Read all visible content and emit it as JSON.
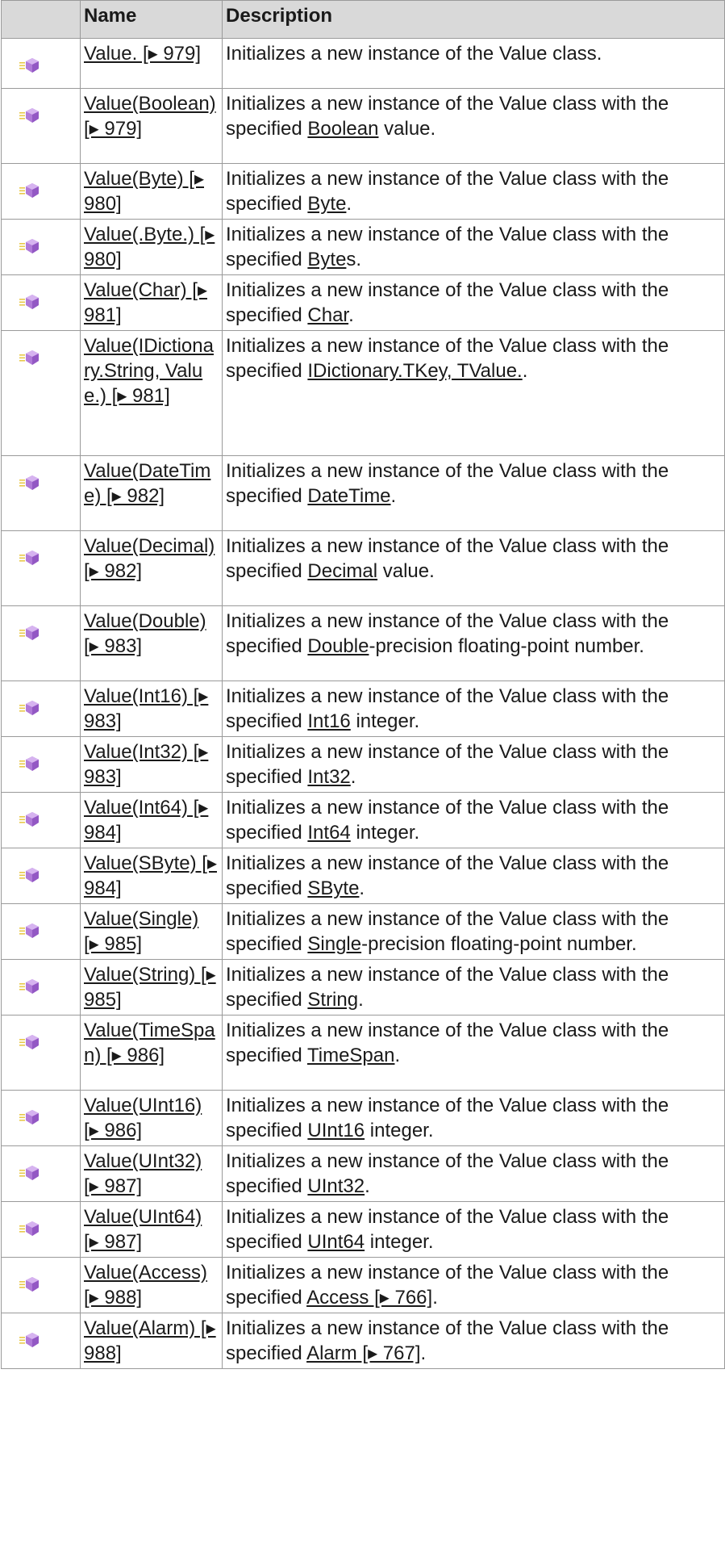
{
  "headers": {
    "icon": "",
    "name": "Name",
    "description": "Description"
  },
  "colors": {
    "header_bg": "#d9d9d9",
    "border": "#9a9a9a",
    "icon_purple": "#b07ad8",
    "icon_yellow": "#e8c94a"
  },
  "rows": [
    {
      "name": "Value. [▸ 979]",
      "pre": "Initializes a new instance of the Value class.",
      "link": "",
      "post": ""
    },
    {
      "name": "Value(Boolean) [▸ 979]",
      "pre": "Initializes a new instance of the Value class with the specified ",
      "link": "Boolean",
      "post": " value."
    },
    {
      "name": "Value(Byte) [▸ 980]",
      "pre": "Initializes a new instance of the Value class with the specified ",
      "link": "Byte",
      "post": "."
    },
    {
      "name": "Value(.Byte.) [▸ 980]",
      "pre": "Initializes a new instance of the Value class with the specified ",
      "link": "Byte",
      "post": "s."
    },
    {
      "name": "Value(Char) [▸ 981]",
      "pre": "Initializes a new instance of the Value class with the specified ",
      "link": "Char",
      "post": "."
    },
    {
      "name": "Value(IDictionary.String, Value.) [▸ 981]",
      "pre": "Initializes a new instance of the Value class with the specified ",
      "link": "IDictionary.TKey, TValue.",
      "post": "."
    },
    {
      "name": "Value(DateTime) [▸ 982]",
      "pre": "Initializes a new instance of the Value class with the specified ",
      "link": "DateTime",
      "post": "."
    },
    {
      "name": "Value(Decimal) [▸ 982]",
      "pre": "Initializes a new instance of the Value class with the specified ",
      "link": "Decimal",
      "post": " value."
    },
    {
      "name": "Value(Double) [▸ 983]",
      "pre": "Initializes a new instance of the Value class with the specified ",
      "link": "Double",
      "post": "-precision floating-point number."
    },
    {
      "name": "Value(Int16) [▸ 983]",
      "pre": "Initializes a new instance of the Value class with the specified ",
      "link": "Int16",
      "post": " integer."
    },
    {
      "name": "Value(Int32) [▸ 983]",
      "pre": "Initializes a new instance of the Value class with the specified ",
      "link": "Int32",
      "post": "."
    },
    {
      "name": "Value(Int64) [▸ 984]",
      "pre": "Initializes a new instance of the Value class with the specified ",
      "link": "Int64",
      "post": " integer."
    },
    {
      "name": "Value(SByte) [▸ 984]",
      "pre": "Initializes a new instance of the Value class with the specified ",
      "link": "SByte",
      "post": "."
    },
    {
      "name": "Value(Single) [▸ 985]",
      "pre": "Initializes a new instance of the Value class with the specified ",
      "link": "Single",
      "post": "-precision floating-point number."
    },
    {
      "name": "Value(String) [▸ 985]",
      "pre": "Initializes a new instance of the Value class with the specified ",
      "link": "String",
      "post": "."
    },
    {
      "name": "Value(TimeSpan) [▸ 986]",
      "pre": "Initializes a new instance of the Value class with the specified ",
      "link": "TimeSpan",
      "post": "."
    },
    {
      "name": "Value(UInt16) [▸ 986]",
      "pre": "Initializes a new instance of the Value class with the specified ",
      "link": "UInt16",
      "post": " integer."
    },
    {
      "name": "Value(UInt32) [▸ 987]",
      "pre": "Initializes a new instance of the Value class with the specified ",
      "link": "UInt32",
      "post": "."
    },
    {
      "name": "Value(UInt64) [▸ 987]",
      "pre": "Initializes a new instance of the Value class with the specified ",
      "link": "UInt64",
      "post": " integer."
    },
    {
      "name": "Value(Access) [▸ 988]",
      "pre": "Initializes a new instance of the Value class with the specified ",
      "link": "Access [▸ 766]",
      "post": "."
    },
    {
      "name": "Value(Alarm) [▸ 988]",
      "pre": "Initializes a new instance of the Value class with the specified ",
      "link": "Alarm [▸ 767]",
      "post": "."
    }
  ]
}
